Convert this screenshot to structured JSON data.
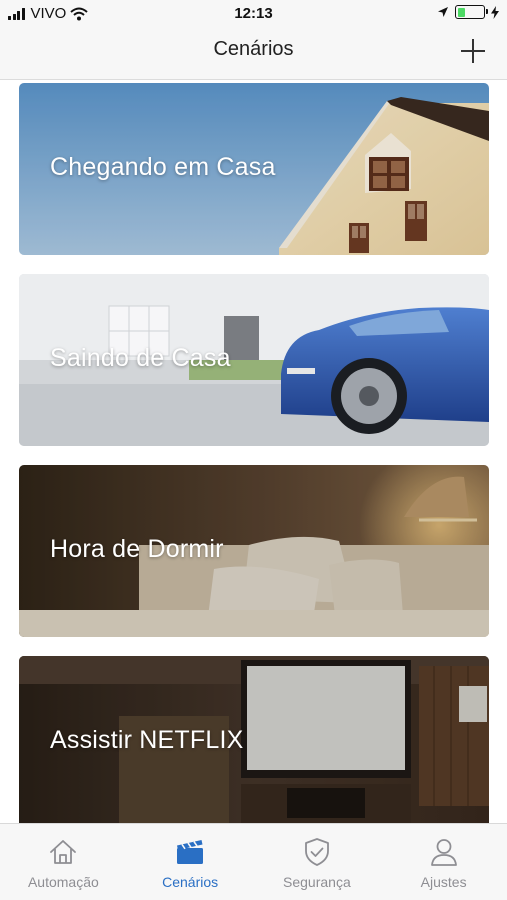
{
  "status_bar": {
    "carrier": "VIVO",
    "time": "12:13"
  },
  "header": {
    "title": "Cenários",
    "add_icon": "plus-icon"
  },
  "scenes": [
    {
      "label": "Chegando em Casa",
      "image": "house-photo"
    },
    {
      "label": "Saindo de Casa",
      "image": "car-photo"
    },
    {
      "label": "Hora de Dormir",
      "image": "bedroom-photo"
    },
    {
      "label": "Assistir NETFLIX",
      "image": "home-theater-photo"
    }
  ],
  "tabbar": {
    "items": [
      {
        "label": "Automação",
        "icon": "home-icon",
        "active": false
      },
      {
        "label": "Cenários",
        "icon": "clapperboard-icon",
        "active": true
      },
      {
        "label": "Segurança",
        "icon": "shield-check-icon",
        "active": false
      },
      {
        "label": "Ajustes",
        "icon": "user-icon",
        "active": false
      }
    ],
    "active_color": "#2a6fc4",
    "inactive_color": "#8e8e93"
  }
}
